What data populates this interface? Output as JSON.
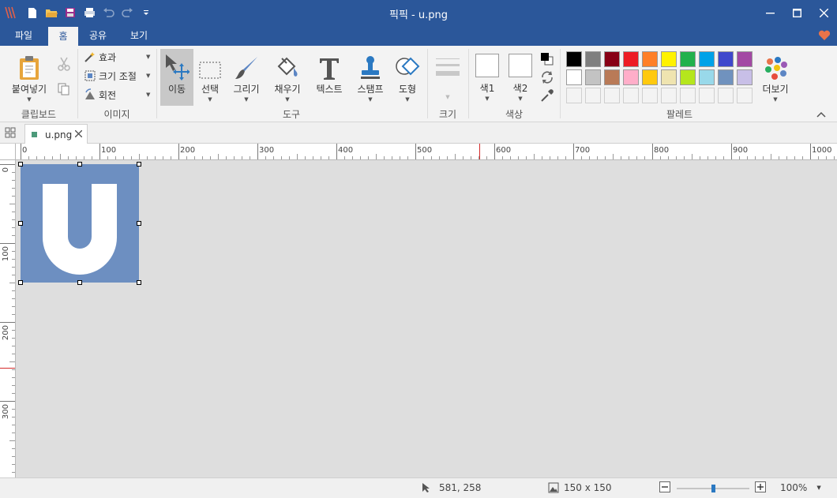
{
  "window": {
    "title": "픽픽 - u.png"
  },
  "menu": {
    "tabs": [
      "파일",
      "홈",
      "공유",
      "보기"
    ],
    "active_tab": "홈"
  },
  "ribbon": {
    "clipboard": {
      "paste_label": "붙여넣기",
      "group_label": "클립보드"
    },
    "image": {
      "effect_label": "효과",
      "resize_label": "크기 조절",
      "rotate_label": "회전",
      "group_label": "이미지"
    },
    "tools": {
      "items": [
        "이동",
        "선택",
        "그리기",
        "채우기",
        "텍스트",
        "스탬프",
        "도형"
      ],
      "selected": "이동",
      "group_label": "도구"
    },
    "size": {
      "group_label": "크기"
    },
    "colors": {
      "color1_label": "색1",
      "color2_label": "색2",
      "group_label": "색상"
    },
    "palette": {
      "group_label": "팔레트",
      "more_label": "더보기",
      "row1": [
        "#000000",
        "#7f7f7f",
        "#880015",
        "#ed1c24",
        "#ff7f27",
        "#fff200",
        "#22b14c",
        "#00a2e8",
        "#3f48cc",
        "#a349a4"
      ],
      "row2": [
        "#ffffff",
        "#c3c3c3",
        "#b97a57",
        "#ffaec9",
        "#ffc90e",
        "#efe4b0",
        "#b5e61d",
        "#99d9ea",
        "#7092be",
        "#c8bfe7"
      ]
    }
  },
  "document": {
    "tab_name": "u.png",
    "image_letter": "U",
    "image_color": "#6d8fc1"
  },
  "rulers": {
    "horizontal": [
      "0",
      "100",
      "200",
      "300",
      "400",
      "500",
      "600",
      "700",
      "800",
      "900",
      "1000"
    ],
    "vertical": [
      "0",
      "100",
      "200",
      "300"
    ]
  },
  "status": {
    "cursor_position": "581, 258",
    "image_size": "150 x 150",
    "zoom": "100%",
    "zoom_level": 0.5
  },
  "colors": {
    "accent": "#2b579a",
    "ribbon_bg": "#f3f3f3",
    "canvas_bg": "#dedede"
  }
}
